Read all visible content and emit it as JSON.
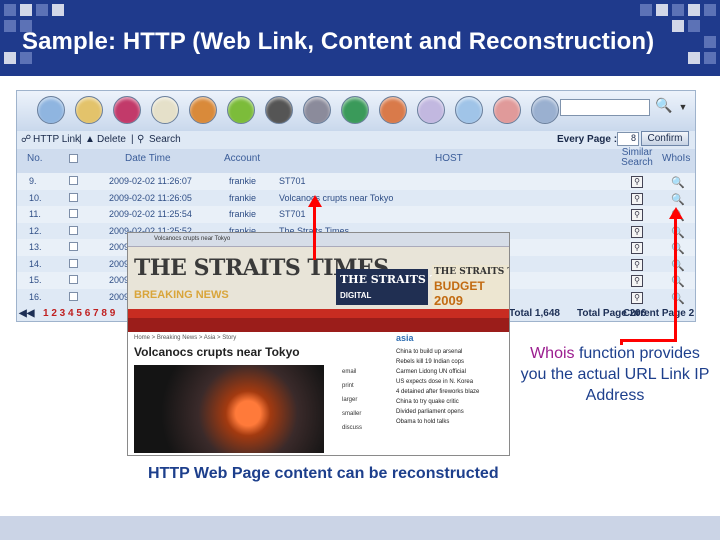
{
  "slide": {
    "title": "Sample: HTTP (Web Link, Content and Reconstruction)",
    "whois_caption": {
      "highlight": "Whois",
      "rest": " function provides you the actual URL Link IP Address"
    },
    "web_caption": "HTTP Web Page content can be reconstructed",
    "accent_red": "#ff0000",
    "title_bg": "#1f3a8c"
  },
  "app": {
    "toolbar_icons": [
      "home-icon",
      "mail-icon",
      "media-icon",
      "calendar-icon",
      "package-icon",
      "ie-icon",
      "im-icon",
      "settings-icon",
      "refresh-icon",
      "tools-icon",
      "edit-icon",
      "search-doc-icon",
      "send-mail-icon",
      "network-icon"
    ],
    "actions": {
      "http_link": "HTTP Link",
      "delete": "Delete",
      "search": "Search",
      "every_page_label": "Every Page :",
      "every_page_value": "8",
      "confirm": "Confirm"
    },
    "columns": {
      "no": "No.",
      "datetime": "Date Time",
      "account": "Account",
      "host": "HOST",
      "similar": "Similar Search",
      "whois": "WhoIs"
    },
    "rows": [
      {
        "no": "9.",
        "datetime": "2009-02-02 11:26:07",
        "account": "frankie",
        "host": "ST701"
      },
      {
        "no": "10.",
        "datetime": "2009-02-02 11:26:05",
        "account": "frankie",
        "host": "Volcanocs crupts near Tokyo"
      },
      {
        "no": "11.",
        "datetime": "2009-02-02 11:25:54",
        "account": "frankie",
        "host": "ST701"
      },
      {
        "no": "12.",
        "datetime": "2009-02-02 11:25:52",
        "account": "frankie",
        "host": "The Straits Times"
      },
      {
        "no": "13.",
        "datetime": "2009",
        "account": "",
        "host": ""
      },
      {
        "no": "14.",
        "datetime": "2009",
        "account": "",
        "host": ""
      },
      {
        "no": "15.",
        "datetime": "2009",
        "account": "",
        "host": ""
      },
      {
        "no": "16.",
        "datetime": "2009",
        "account": "",
        "host": ""
      }
    ],
    "pager": {
      "pages": "1 2 3 4 5 6 7 8 9",
      "total": "Total 1,648",
      "total_page": "Total Page 206",
      "current_page": "Current Page 2"
    }
  },
  "webpage": {
    "tab_text": "Volcanocs crupts near Tokyo",
    "logo": "THE STRAITS TIMES.",
    "breaking": "BREAKING NEWS",
    "digital": "THE STRAITS TIMES",
    "digital_sub": "DIGITAL",
    "budget_top": "THE STRAITS TIMES",
    "budget_word": "BUDGET",
    "budget_year": "2009",
    "breadcrumb": "Home > Breaking News > Asia > Story",
    "article_title": "Volcanocs crupts near Tokyo",
    "tools": [
      "email",
      "print",
      "larger",
      "smaller",
      "discuss"
    ],
    "asia_label": "asia",
    "asia_items": [
      "China to build up arsenal",
      "Rebels kill 19 Indian cops",
      "Carmen Lidong UN official",
      "US expects dose in N. Korea",
      "4 detained after fireworks blaze",
      "China to try quake critic",
      "Divided parliament opens",
      "Obama to hold talks"
    ]
  }
}
